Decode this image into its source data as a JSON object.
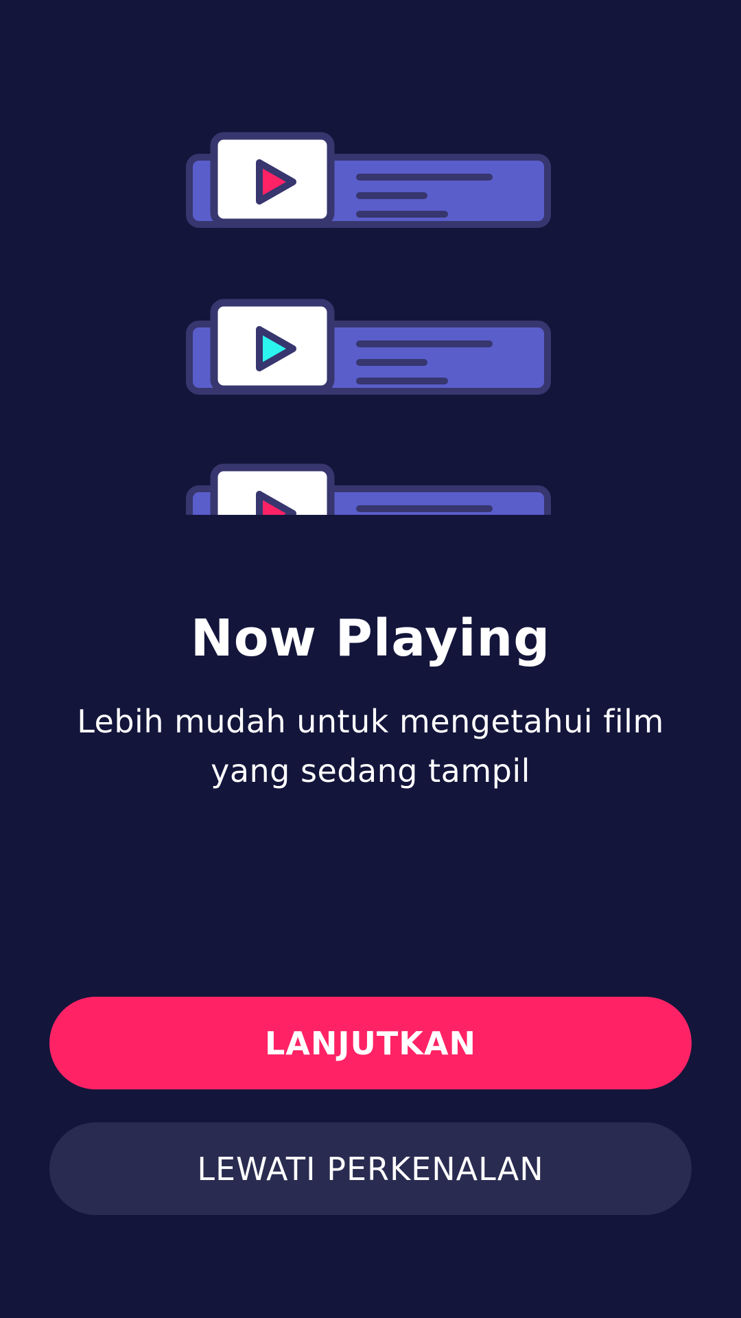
{
  "onboarding": {
    "title": "Now Playing",
    "subtitle": "Lebih mudah untuk mengetahui film yang sedang tampil",
    "primary_button_label": "LANJUTKAN",
    "secondary_button_label": "LEWATI PERKENALAN"
  },
  "illustration": {
    "cards": [
      {
        "icon": "play-icon",
        "play_color": "#ff2366"
      },
      {
        "icon": "play-icon",
        "play_color": "#2bf5ee"
      },
      {
        "icon": "play-icon",
        "play_color": "#ff2366"
      }
    ]
  },
  "colors": {
    "background": "#13153b",
    "card_fill": "#5a5ecb",
    "card_border": "#37366e",
    "accent_pink": "#ff2366",
    "accent_cyan": "#2bf5ee",
    "secondary_button": "#2a2b51"
  }
}
